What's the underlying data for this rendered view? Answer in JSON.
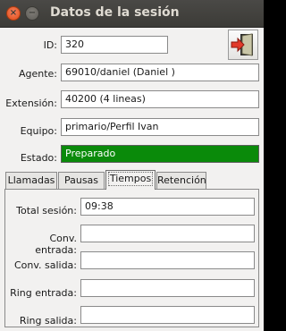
{
  "window": {
    "title": "Datos de la sesión",
    "close_icon": "close-icon",
    "minimize_icon": "minimize-icon"
  },
  "session": {
    "id_label": "ID:",
    "id_value": "320",
    "agent_label": "Agente:",
    "agent_value": "69010/daniel (Daniel )",
    "extension_label": "Extensión:",
    "extension_value": "40200 (4 lineas)",
    "team_label": "Equipo:",
    "team_value": "primario/Perfil Ivan",
    "state_label": "Estado:",
    "state_value": "Preparado",
    "state_color": "#0a8a0a",
    "exit_icon": "exit-door-icon"
  },
  "tabs": [
    {
      "label": "Llamadas",
      "active": false
    },
    {
      "label": "Pausas",
      "active": false
    },
    {
      "label": "Tiempos",
      "active": true
    },
    {
      "label": "Retención",
      "active": false
    }
  ],
  "times": {
    "total_label": "Total sesión:",
    "total_value": "09:38",
    "conv_in_label": "Conv. entrada:",
    "conv_in_value": "",
    "conv_out_label": "Conv. salida:",
    "conv_out_value": "",
    "ring_in_label": "Ring entrada:",
    "ring_in_value": "",
    "ring_out_label": "Ring salida:",
    "ring_out_value": ""
  }
}
